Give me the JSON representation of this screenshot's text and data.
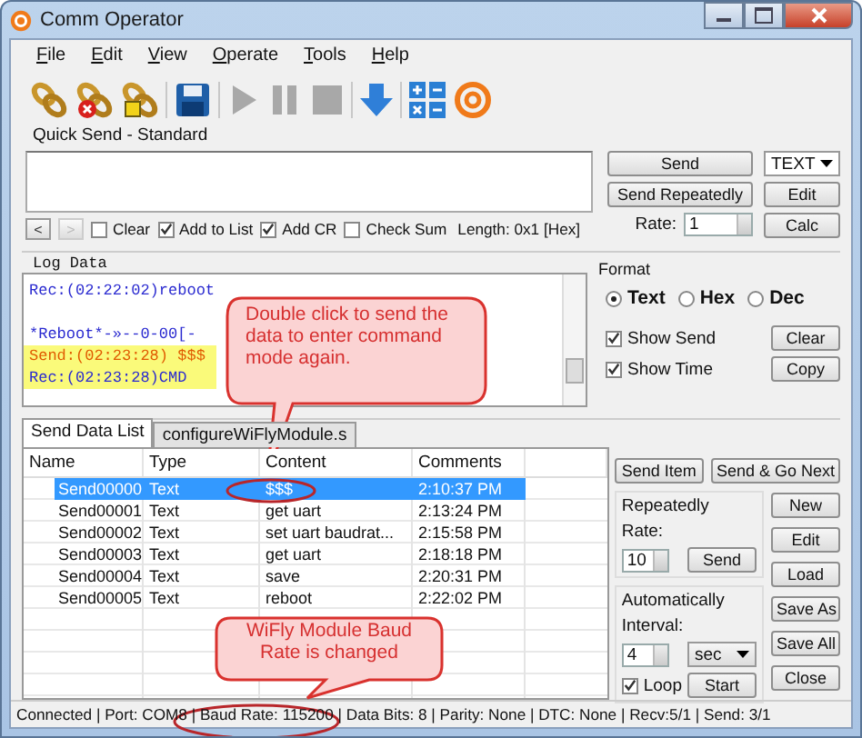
{
  "window": {
    "title": "Comm Operator"
  },
  "menu": [
    {
      "label": "File"
    },
    {
      "label": "Edit"
    },
    {
      "label": "View"
    },
    {
      "label": "Operate"
    },
    {
      "label": "Tools"
    },
    {
      "label": "Help"
    }
  ],
  "quick_send": {
    "title": "Quick Send - Standard",
    "nav": [
      {
        "label": "<",
        "disabled": false
      },
      {
        "label": ">",
        "disabled": true
      }
    ],
    "options": [
      {
        "label": "Clear",
        "checked": false
      },
      {
        "label": "Add to List",
        "checked": true
      },
      {
        "label": "Add CR",
        "checked": true
      },
      {
        "label": "Check Sum",
        "checked": false
      }
    ],
    "length": "Length: 0x1 [Hex]",
    "send": "Send",
    "send_repeatedly": "Send Repeatedly",
    "rate_label": "Rate:",
    "rate": "1",
    "mode": "TEXT",
    "edit": "Edit",
    "calc": "Calc"
  },
  "log": {
    "title": "Log Data",
    "lines": [
      {
        "text": "Rec:(02:22:02)reboot",
        "kind": "rec",
        "highlighted": false
      },
      {
        "kind": "blank",
        "highlighted": false
      },
      {
        "text": "*Reboot*-»--0-00[-",
        "kind": "rec",
        "highlighted": false
      },
      {
        "text": "Send:(02:23:28) $$$",
        "kind": "send",
        "highlighted": true
      },
      {
        "text": "Rec:(02:23:28)CMD",
        "kind": "rec",
        "highlighted": true
      }
    ],
    "format": {
      "title": "Format",
      "options": [
        {
          "label": "Text",
          "selected": true
        },
        {
          "label": "Hex",
          "selected": false
        },
        {
          "label": "Dec",
          "selected": false
        }
      ]
    },
    "toggles": [
      {
        "label": "Show Send",
        "checked": true,
        "button": "Clear"
      },
      {
        "label": "Show Time",
        "checked": true,
        "button": "Copy"
      }
    ]
  },
  "tabs": [
    {
      "label": "Send Data List",
      "selected": true
    },
    {
      "label": "configureWiFlyModule.s",
      "selected": false
    }
  ],
  "table": {
    "columns": [
      "Name",
      "Type",
      "Content",
      "Comments"
    ],
    "rows": [
      {
        "cells": [
          "Send00000",
          "Text",
          "$$$",
          "2:10:37 PM"
        ],
        "selected": true
      },
      {
        "cells": [
          "Send00001",
          "Text",
          "get uart",
          "2:13:24 PM"
        ],
        "selected": false
      },
      {
        "cells": [
          "Send00002",
          "Text",
          "set uart baudrat...",
          "2:15:58 PM"
        ],
        "selected": false
      },
      {
        "cells": [
          "Send00003",
          "Text",
          "get uart",
          "2:18:18 PM"
        ],
        "selected": false
      },
      {
        "cells": [
          "Send00004",
          "Text",
          "save",
          "2:20:31 PM"
        ],
        "selected": false
      },
      {
        "cells": [
          "Send00005",
          "Text",
          "reboot",
          "2:22:02 PM"
        ],
        "selected": false
      }
    ]
  },
  "panel": {
    "send_item": "Send Item",
    "send_next": "Send & Go Next",
    "repeat": {
      "title": "Repeatedly",
      "rate_label": "Rate:",
      "rate": "10",
      "button": "Send"
    },
    "auto": {
      "title": "Automatically",
      "interval_label": "Interval:",
      "interval": "4",
      "unit": "sec",
      "loop": {
        "label": "Loop",
        "checked": true
      },
      "button": "Start"
    },
    "buttons": [
      "New",
      "Edit",
      "Load",
      "Save As",
      "Save All",
      "Close"
    ]
  },
  "callouts": [
    {
      "text": "Double click to send the data to enter command mode again."
    },
    {
      "text": "WiFly Module Baud Rate is changed"
    }
  ],
  "status_bar": "Connected | Port: COM8 | Baud Rate: 115200 | Data Bits: 8 | Parity: None | DTC: None | Recv:5/1 | Send: 3/1"
}
